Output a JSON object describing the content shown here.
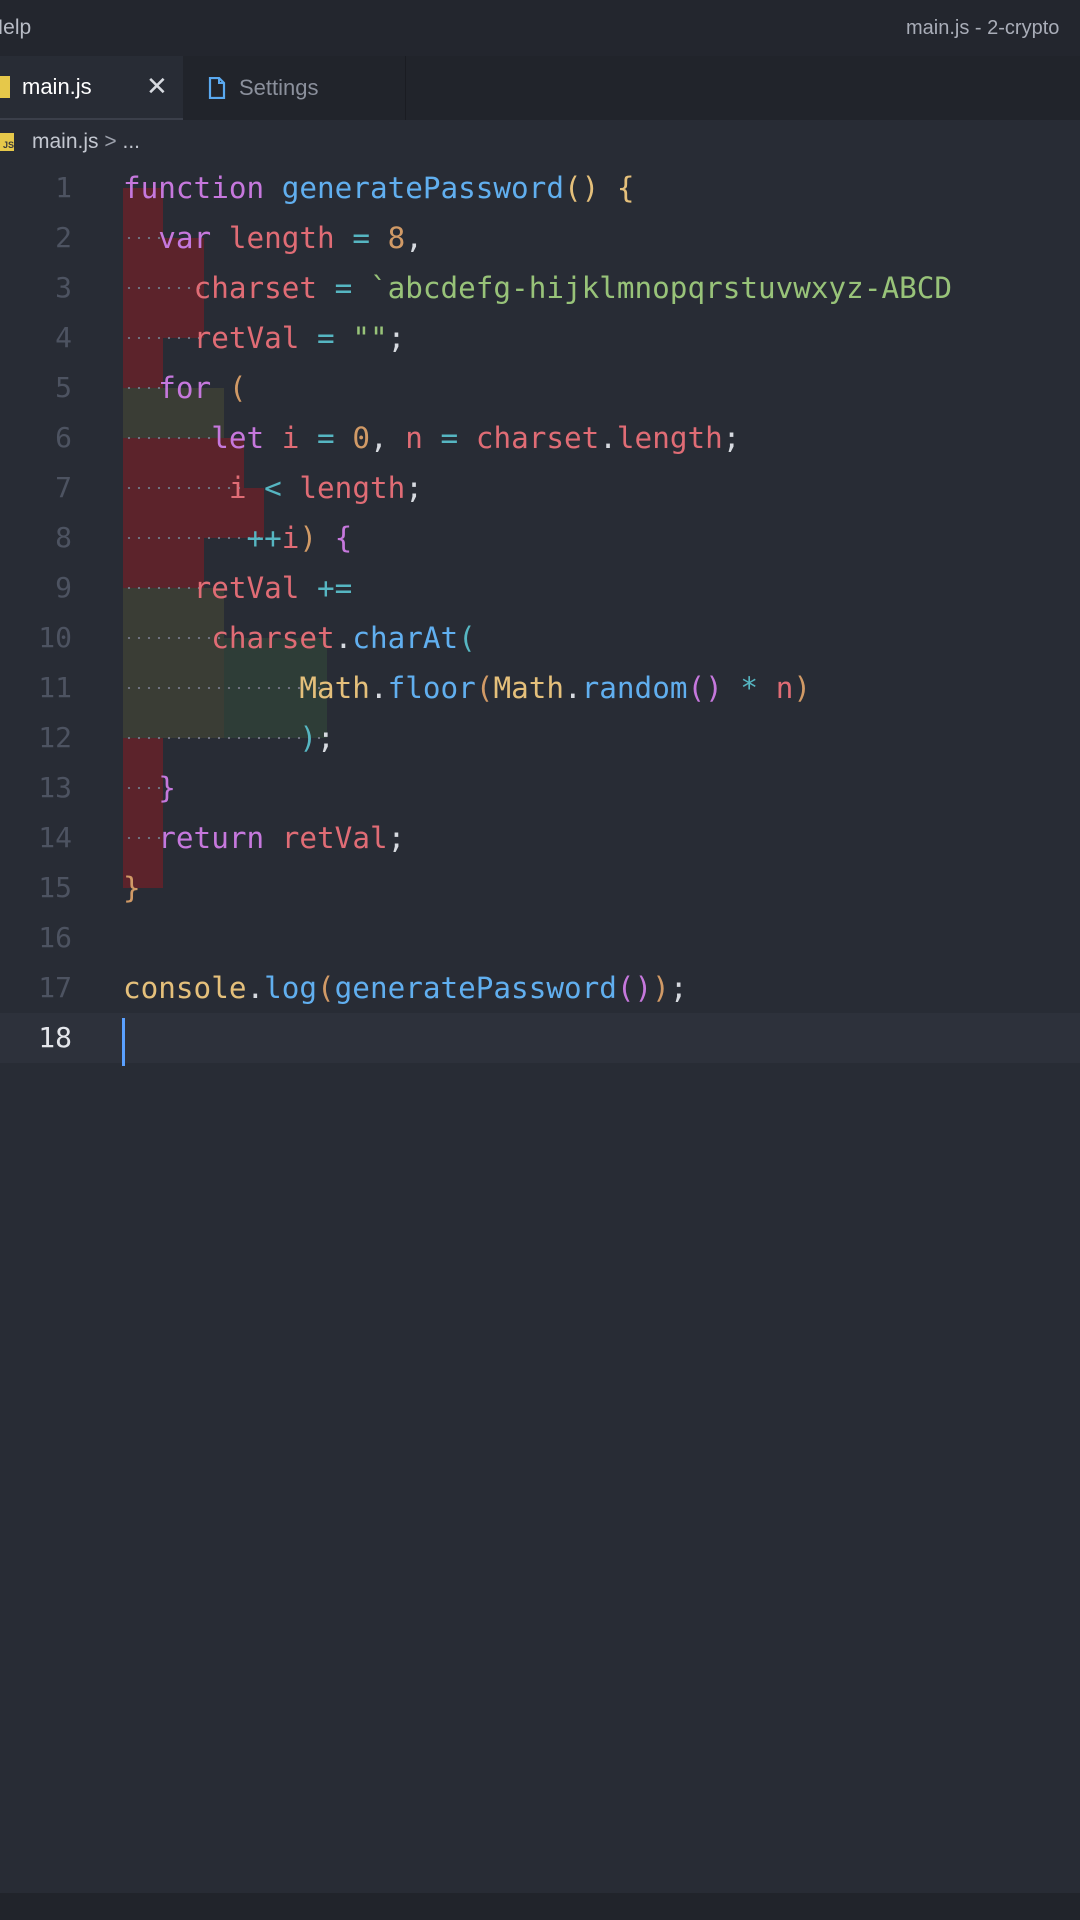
{
  "titlebar": {
    "menu_label": "Help",
    "window_title": "main.js - 2-crypto"
  },
  "tabs": [
    {
      "label": "main.js",
      "icon": "js-file-icon",
      "active": true,
      "close": "✕"
    },
    {
      "label": "Settings",
      "icon": "settings-file-icon",
      "active": false
    }
  ],
  "breadcrumb": {
    "file": "main.js",
    "separator": ">",
    "rest": "..."
  },
  "editor": {
    "line_numbers": [
      "1",
      "2",
      "3",
      "4",
      "5",
      "6",
      "7",
      "8",
      "9",
      "10",
      "11",
      "12",
      "13",
      "14",
      "15",
      "16",
      "17",
      "18"
    ],
    "current_line": "18",
    "lines": [
      "function generatePassword() {",
      "  var length = 8,",
      "    charset = `abcdefg-hijklmnopqrstuvwxyz-ABCD",
      "    retVal = \"\";",
      "  for (",
      "      let i = 0, n = charset.length;",
      "       i < length;",
      "        ++i) {",
      "    retVal +=",
      "      charset.charAt(",
      "           Math.floor(Math.random() * n)",
      "           );",
      "  }",
      "  return retVal;",
      "}",
      "",
      "console.log(generatePassword());",
      ""
    ]
  },
  "colors": {
    "background": "#282c35",
    "keyword": "#c678dd",
    "function": "#61afef",
    "variable": "#e06c75",
    "string": "#98c379",
    "number": "#d19a66",
    "operator": "#56b6c2",
    "cursor": "#5aa0ff"
  }
}
